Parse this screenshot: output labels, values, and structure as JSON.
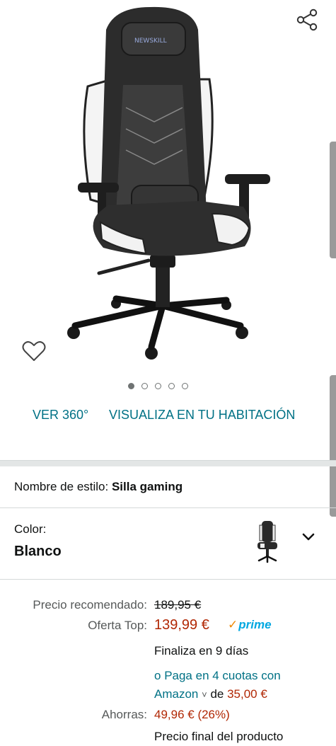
{
  "icons": {
    "share": "share-icon",
    "wishlist": "heart-icon",
    "dropdown": "chevron-down-icon"
  },
  "colors": {
    "link": "#007185",
    "price": "#b12704",
    "prime": "#00a8e1",
    "muted": "#565959"
  },
  "gallery": {
    "image": "gaming-chair-image",
    "brand_text": "NEWSKILL",
    "dots_total": 5,
    "dots_active": 1
  },
  "media_links": {
    "view_360": "VER 360°",
    "view_room": "VISUALIZA EN TU HABITACIÓN"
  },
  "style": {
    "label": "Nombre de estilo:",
    "value": "Silla gaming"
  },
  "color": {
    "label": "Color:",
    "value": "Blanco"
  },
  "price": {
    "list_label": "Precio recomendado:",
    "list_value": "189,95 €",
    "deal_label": "Oferta Top:",
    "deal_value": "139,99 €",
    "prime": "prime",
    "ends": "Finaliza en 9 días",
    "installments_prefix": "o ",
    "installments_link": "Paga en 4 cuotas con Amazon",
    "installments_de": "de",
    "installments_amount": "35,00 €",
    "savings_label": "Ahorras:",
    "savings_value": "49,96 € (26%)",
    "final_note": "Precio final del producto"
  }
}
